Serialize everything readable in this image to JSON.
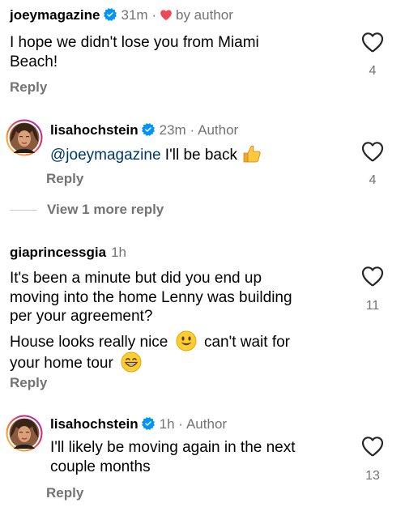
{
  "comments": [
    {
      "username": "joeymagazine",
      "time": "31m",
      "separator": "·",
      "tag": "by author",
      "lines": [
        "I hope we didn't lose you from Miami",
        "Beach!"
      ],
      "reply_label": "Reply",
      "like_count": "4",
      "liked_by_author": true
    },
    {
      "username": "lisahochstein",
      "time": "23m",
      "separator": "·",
      "tag": "Author",
      "mention": "@joeymagazine",
      "text": " I'll be back",
      "emoji": "thumbs-up",
      "reply_label": "Reply",
      "like_count": "4"
    },
    {
      "username": "giaprincessgia",
      "time": "1h",
      "lines": [
        "It's been a minute but did you end up",
        "moving into the home Lenny was building",
        "per your agreement?"
      ],
      "line4_a": "House looks really nice",
      "line4_b": "can't wait for",
      "line5": "your home tour",
      "reply_label": "Reply",
      "like_count": "11"
    },
    {
      "username": "lisahochstein",
      "time": "1h",
      "separator": "·",
      "tag": "Author",
      "lines": [
        "I'll likely be moving again in the next",
        "couple months"
      ],
      "reply_label": "Reply",
      "like_count": "13"
    }
  ],
  "view_more_label": "View 1 more reply",
  "colors": {
    "secondary_text": "#737373",
    "mention": "#00376b",
    "verified": "#0095f6",
    "heart": "#ed4956"
  }
}
